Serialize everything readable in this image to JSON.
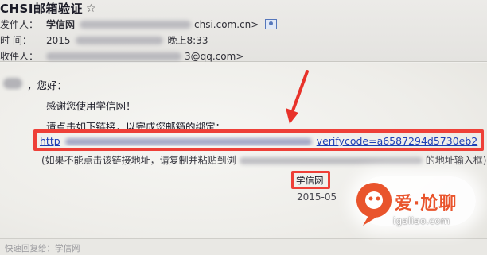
{
  "header": {
    "subject": "CHSI邮箱验证",
    "sender_label": "发件人：",
    "sender_name": "学信网",
    "sender_domain": "chsi.com.cn>",
    "time_label": "时 间：",
    "time_prefix": "2015",
    "time_suffix": "晚上8:33",
    "recipient_label": "收件人：",
    "recipient_suffix": "3@qq.com>"
  },
  "message": {
    "greeting": "，您好：",
    "thanks": "感谢您使用学信网！",
    "instruction": "请点击如下链接，以完成您邮箱的绑定：",
    "link_prefix": "http",
    "link_tail": "verifycode=a6587294d5730eb2",
    "hint_prefix": "(如果不能点击该链接地址，请复制并粘贴到浏",
    "hint_suffix": "的地址输入框)",
    "signature": "学信网",
    "date": "2015-05"
  },
  "footer": {
    "quick_reply": "快速回复给：学信网"
  },
  "watermark": {
    "text": "爱·尬聊",
    "site": "igaliao.com"
  },
  "colors": {
    "highlight": "#ee4038",
    "link": "#1d3fb5",
    "watermark": "#e9542c"
  }
}
